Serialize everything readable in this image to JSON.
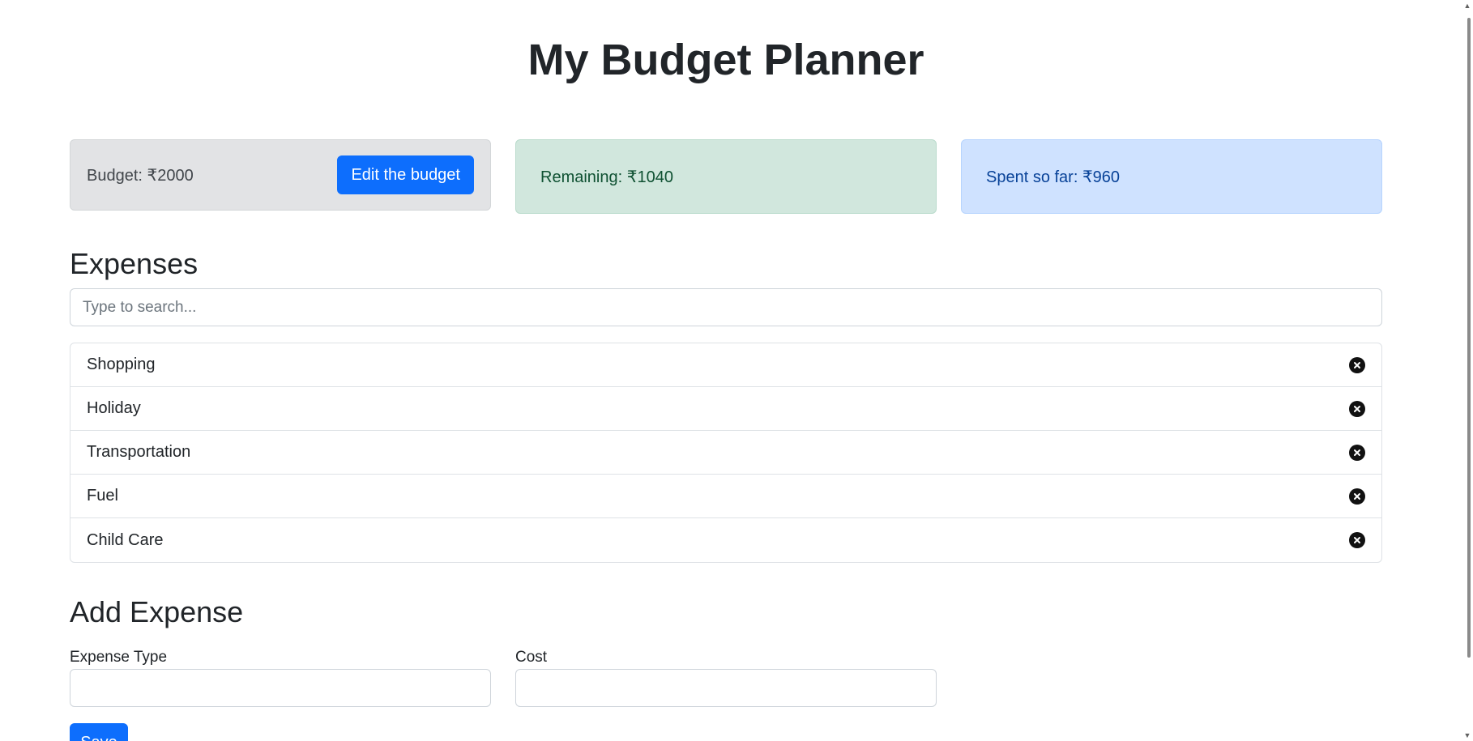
{
  "app": {
    "title": "My Budget Planner"
  },
  "summary": {
    "budget_label": "Budget: ₹2000",
    "edit_button": "Edit the budget",
    "remaining_label": "Remaining: ₹1040",
    "spent_label": "Spent so far: ₹960"
  },
  "expenses": {
    "heading": "Expenses",
    "search_placeholder": "Type to search...",
    "items": [
      {
        "name": "Shopping"
      },
      {
        "name": "Holiday"
      },
      {
        "name": "Transportation"
      },
      {
        "name": "Fuel"
      },
      {
        "name": "Child Care"
      }
    ],
    "delete_icon": "x-circle-icon"
  },
  "add_expense": {
    "heading": "Add Expense",
    "type_label": "Expense Type",
    "type_value": "",
    "cost_label": "Cost",
    "cost_value": "",
    "save_button": "Save"
  },
  "colors": {
    "primary": "#0d6efd",
    "budget_bg": "#e2e3e5",
    "remaining_bg": "#d1e7dd",
    "spent_bg": "#cfe2ff"
  }
}
